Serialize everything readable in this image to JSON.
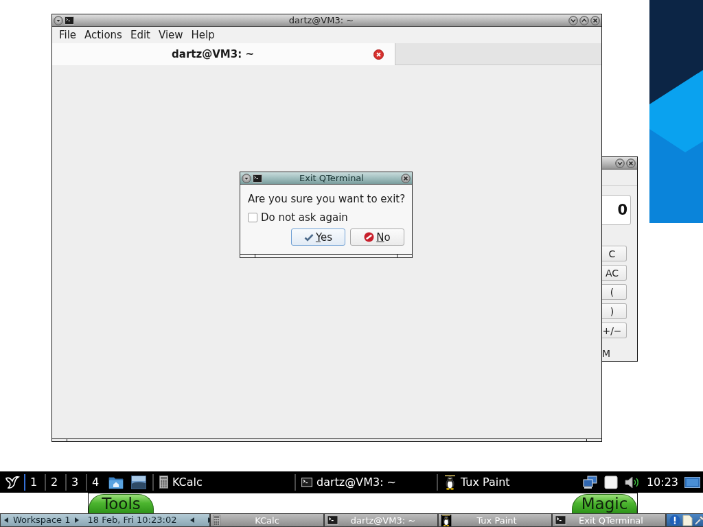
{
  "terminal_window": {
    "title": "dartz@VM3: ~",
    "menu": [
      "File",
      "Actions",
      "Edit",
      "View",
      "Help"
    ],
    "tabs": [
      {
        "label": "dartz@VM3: ~",
        "selected": true
      }
    ]
  },
  "calculator_window": {
    "display": "0",
    "keys": [
      "C",
      "AC",
      "(",
      ")",
      "+/−"
    ],
    "text_1": "M"
  },
  "dialog": {
    "title": "Exit QTerminal",
    "message": "Are you sure you want to exit?",
    "checkbox": {
      "label": "Do not ask again",
      "checked": false
    },
    "buttons": [
      {
        "label": "Yes",
        "kind": "accept",
        "focused": true
      },
      {
        "label": "No",
        "kind": "reject",
        "focused": false
      }
    ]
  },
  "paint_window": {
    "buttons": [
      "Tools",
      "Magic"
    ]
  },
  "taskbar": {
    "workspaces": [
      {
        "label": "1",
        "selected": true
      },
      {
        "label": "2",
        "selected": false
      },
      {
        "label": "3",
        "selected": false
      },
      {
        "label": "4",
        "selected": false
      }
    ],
    "tasks": [
      {
        "label": "KCalc",
        "kind": "calculator"
      },
      {
        "label": "dartz@VM3: ~",
        "kind": "terminal"
      },
      {
        "label": "Tux Paint",
        "kind": "paint"
      }
    ],
    "clock": "10:23"
  },
  "bottom_panel": {
    "workspace": "Workspace 1",
    "date_time": "18 Feb, Fri 10:23:02",
    "tasks": [
      {
        "label": "KCalc",
        "kind": "calculator"
      },
      {
        "label": "dartz@VM3: ~",
        "kind": "terminal"
      },
      {
        "label": "Tux Paint",
        "kind": "paint"
      },
      {
        "label": "Exit QTerminal",
        "kind": "terminal"
      }
    ]
  }
}
